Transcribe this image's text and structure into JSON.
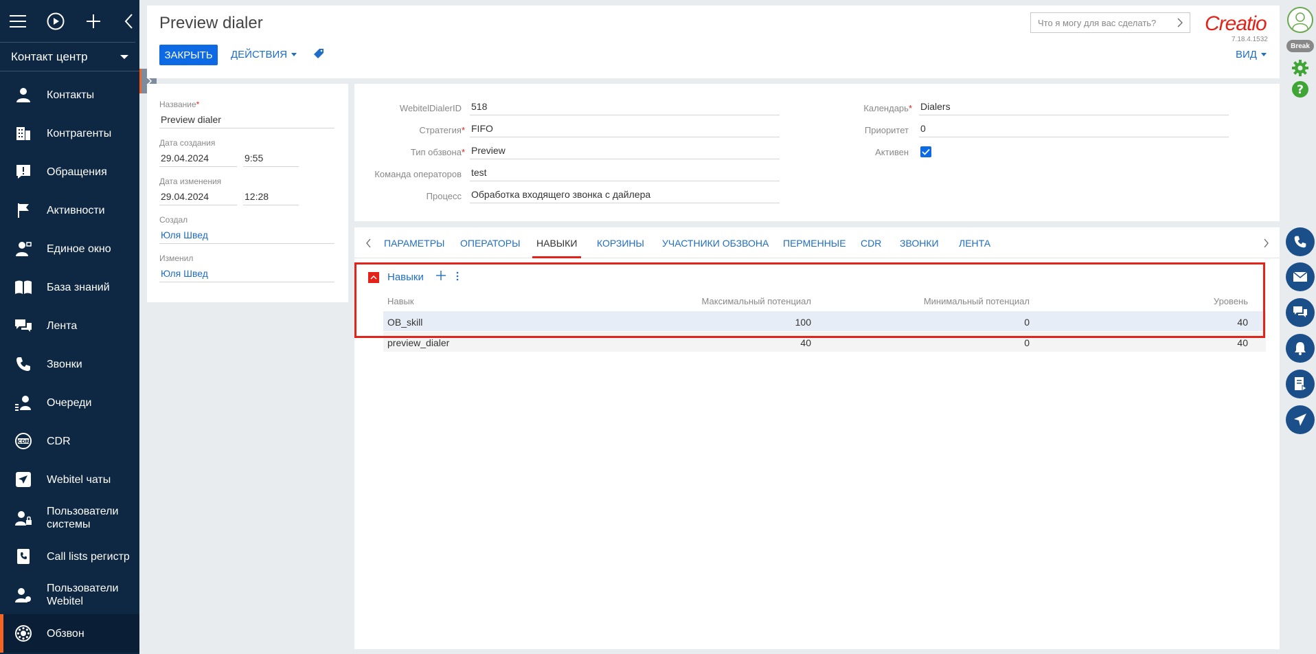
{
  "sidebar": {
    "workspace": "Контакт центр",
    "items": [
      {
        "label": "Контакты",
        "icon": "person-icon"
      },
      {
        "label": "Контрагенты",
        "icon": "building-icon"
      },
      {
        "label": "Обращения",
        "icon": "exclamation-icon"
      },
      {
        "label": "Активности",
        "icon": "flag-icon"
      },
      {
        "label": "Единое окно",
        "icon": "person-window-icon"
      },
      {
        "label": "База знаний",
        "icon": "book-icon"
      },
      {
        "label": "Лента",
        "icon": "feed-icon"
      },
      {
        "label": "Звонки",
        "icon": "phone-icon"
      },
      {
        "label": "Очереди",
        "icon": "queue-icon"
      },
      {
        "label": "CDR",
        "icon": "cdr-icon"
      },
      {
        "label": "Webitel чаты",
        "icon": "send-icon"
      },
      {
        "label": "Пользователи системы",
        "icon": "user-lock-icon"
      },
      {
        "label": "Call lists регистр",
        "icon": "phone-book-icon"
      },
      {
        "label": "Пользователи Webitel",
        "icon": "users-icon"
      },
      {
        "label": "Обзвон",
        "icon": "dialer-icon"
      }
    ]
  },
  "header": {
    "title": "Preview dialer",
    "close_label": "ЗАКРЫТЬ",
    "actions_label": "ДЕЙСТВИЯ",
    "search_placeholder": "Что я могу для вас сделать?",
    "logo": "Creatio",
    "version": "7.18.4.1532",
    "view_label": "ВИД"
  },
  "rail": {
    "status_badge": "Break"
  },
  "left_form": {
    "name_label": "Название",
    "name_value": "Preview dialer",
    "created_label": "Дата создания",
    "created_date": "29.04.2024",
    "created_time": "9:55",
    "modified_label": "Дата изменения",
    "modified_date": "29.04.2024",
    "modified_time": "12:28",
    "created_by_label": "Создал",
    "created_by": "Юля Швед",
    "modified_by_label": "Изменил",
    "modified_by": "Юля Швед"
  },
  "main_form": {
    "dialer_id_label": "WebitelDialerID",
    "dialer_id": "518",
    "strategy_label": "Стратегия",
    "strategy": "FIFO",
    "call_type_label": "Тип обзвона",
    "call_type": "Preview",
    "team_label": "Команда операторов",
    "team": "test",
    "process_label": "Процесс",
    "process": "Обработка входящего звонка с дайлера",
    "calendar_label": "Календарь",
    "calendar": "Dialers",
    "priority_label": "Приоритет",
    "priority": "0",
    "active_label": "Активен",
    "active": true
  },
  "tabs": [
    {
      "label": "ПАРАМЕТРЫ"
    },
    {
      "label": "ОПЕРАТОРЫ"
    },
    {
      "label": "НАВЫКИ",
      "active": true
    },
    {
      "label": "КОРЗИНЫ"
    },
    {
      "label": "УЧАСТНИКИ ОБЗВОНА"
    },
    {
      "label": "ПЕРМЕННЫЕ"
    },
    {
      "label": "CDR"
    },
    {
      "label": "ЗВОНКИ"
    },
    {
      "label": "ЛЕНТА"
    }
  ],
  "skills": {
    "title": "Навыки",
    "columns": [
      "Навык",
      "Максимальный потенциал",
      "Минимальный потенциал",
      "Уровень"
    ],
    "rows": [
      {
        "skill": "OB_skill",
        "max": "100",
        "min": "0",
        "level": "40"
      },
      {
        "skill": "preview_dialer",
        "max": "40",
        "min": "0",
        "level": "40"
      }
    ]
  },
  "colors": {
    "sidebar_bg": "#0e2844",
    "accent_blue": "#0d6ae4",
    "link_blue": "#1e6dc8",
    "accent_red": "#e2231a",
    "active_indicator": "#f26522"
  }
}
